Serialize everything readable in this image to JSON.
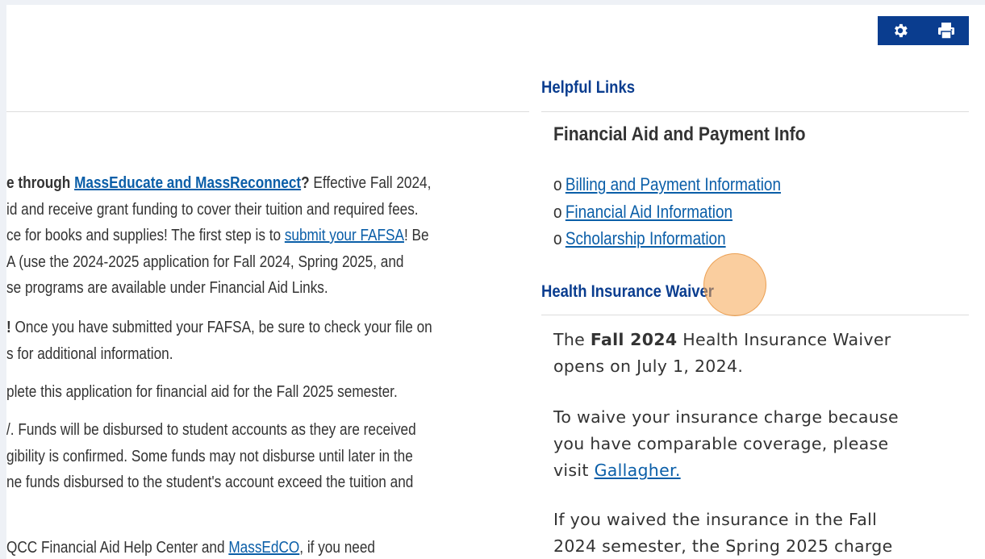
{
  "toolbar": {
    "settings_icon": "gear-icon",
    "print_icon": "print-icon"
  },
  "left": {
    "p1": {
      "l1_b": "e through ",
      "l1_link": "MassEducate and MassReconnect",
      "l1_b2": "?",
      "l1_text": " Effective Fall 2024,",
      "l2": "id and receive grant funding to cover their tuition and required fees.",
      "l3_a": "ce for books and supplies! The first step is to ",
      "l3_link": "submit your FAFSA",
      "l3_b": "!  Be",
      "l4": "A (use the 2024-2025 application for Fall 2024, Spring 2025, and",
      "l5": "se programs are available under Financial Aid Links."
    },
    "p2": {
      "l1_b": "!",
      "l1_text": "  Once you have submitted your FAFSA, be sure to check your file on",
      "l2": "s for additional information."
    },
    "p3": {
      "l1": "plete this application for financial aid for the Fall 2025 semester."
    },
    "p4": {
      "l1": "/. Funds will be disbursed to student accounts as they are received",
      "l2": "gibility is confirmed. Some funds may not disburse until later in the",
      "l3": "ne funds disbursed to the student's account exceed the tuition and"
    },
    "p5": {
      "a": "QCC Financial Aid Help Center and ",
      "link": "MassEdCO",
      "b": ", if you need"
    }
  },
  "helpful": {
    "heading": "Helpful Links",
    "subheading": "Financial Aid and Payment Info",
    "bullet": "o",
    "links": [
      "Billing and Payment Information",
      "Financial Aid Information",
      "Scholarship Information"
    ]
  },
  "insurance": {
    "heading": "Health Insurance Waiver",
    "p1_a": "The ",
    "p1_b": "Fall 2024",
    "p1_c": " Health Insurance Waiver",
    "p1_l2": "opens on July 1, 2024.",
    "p2_l1": "To waive your insurance charge because",
    "p2_l2": "you have comparable coverage, please",
    "p2_l3a": "visit ",
    "p2_link": "Gallagher.",
    "p3_l1": "If you waived the insurance in the Fall",
    "p3_l2": "2024 semester, the Spring 2025 charge"
  }
}
